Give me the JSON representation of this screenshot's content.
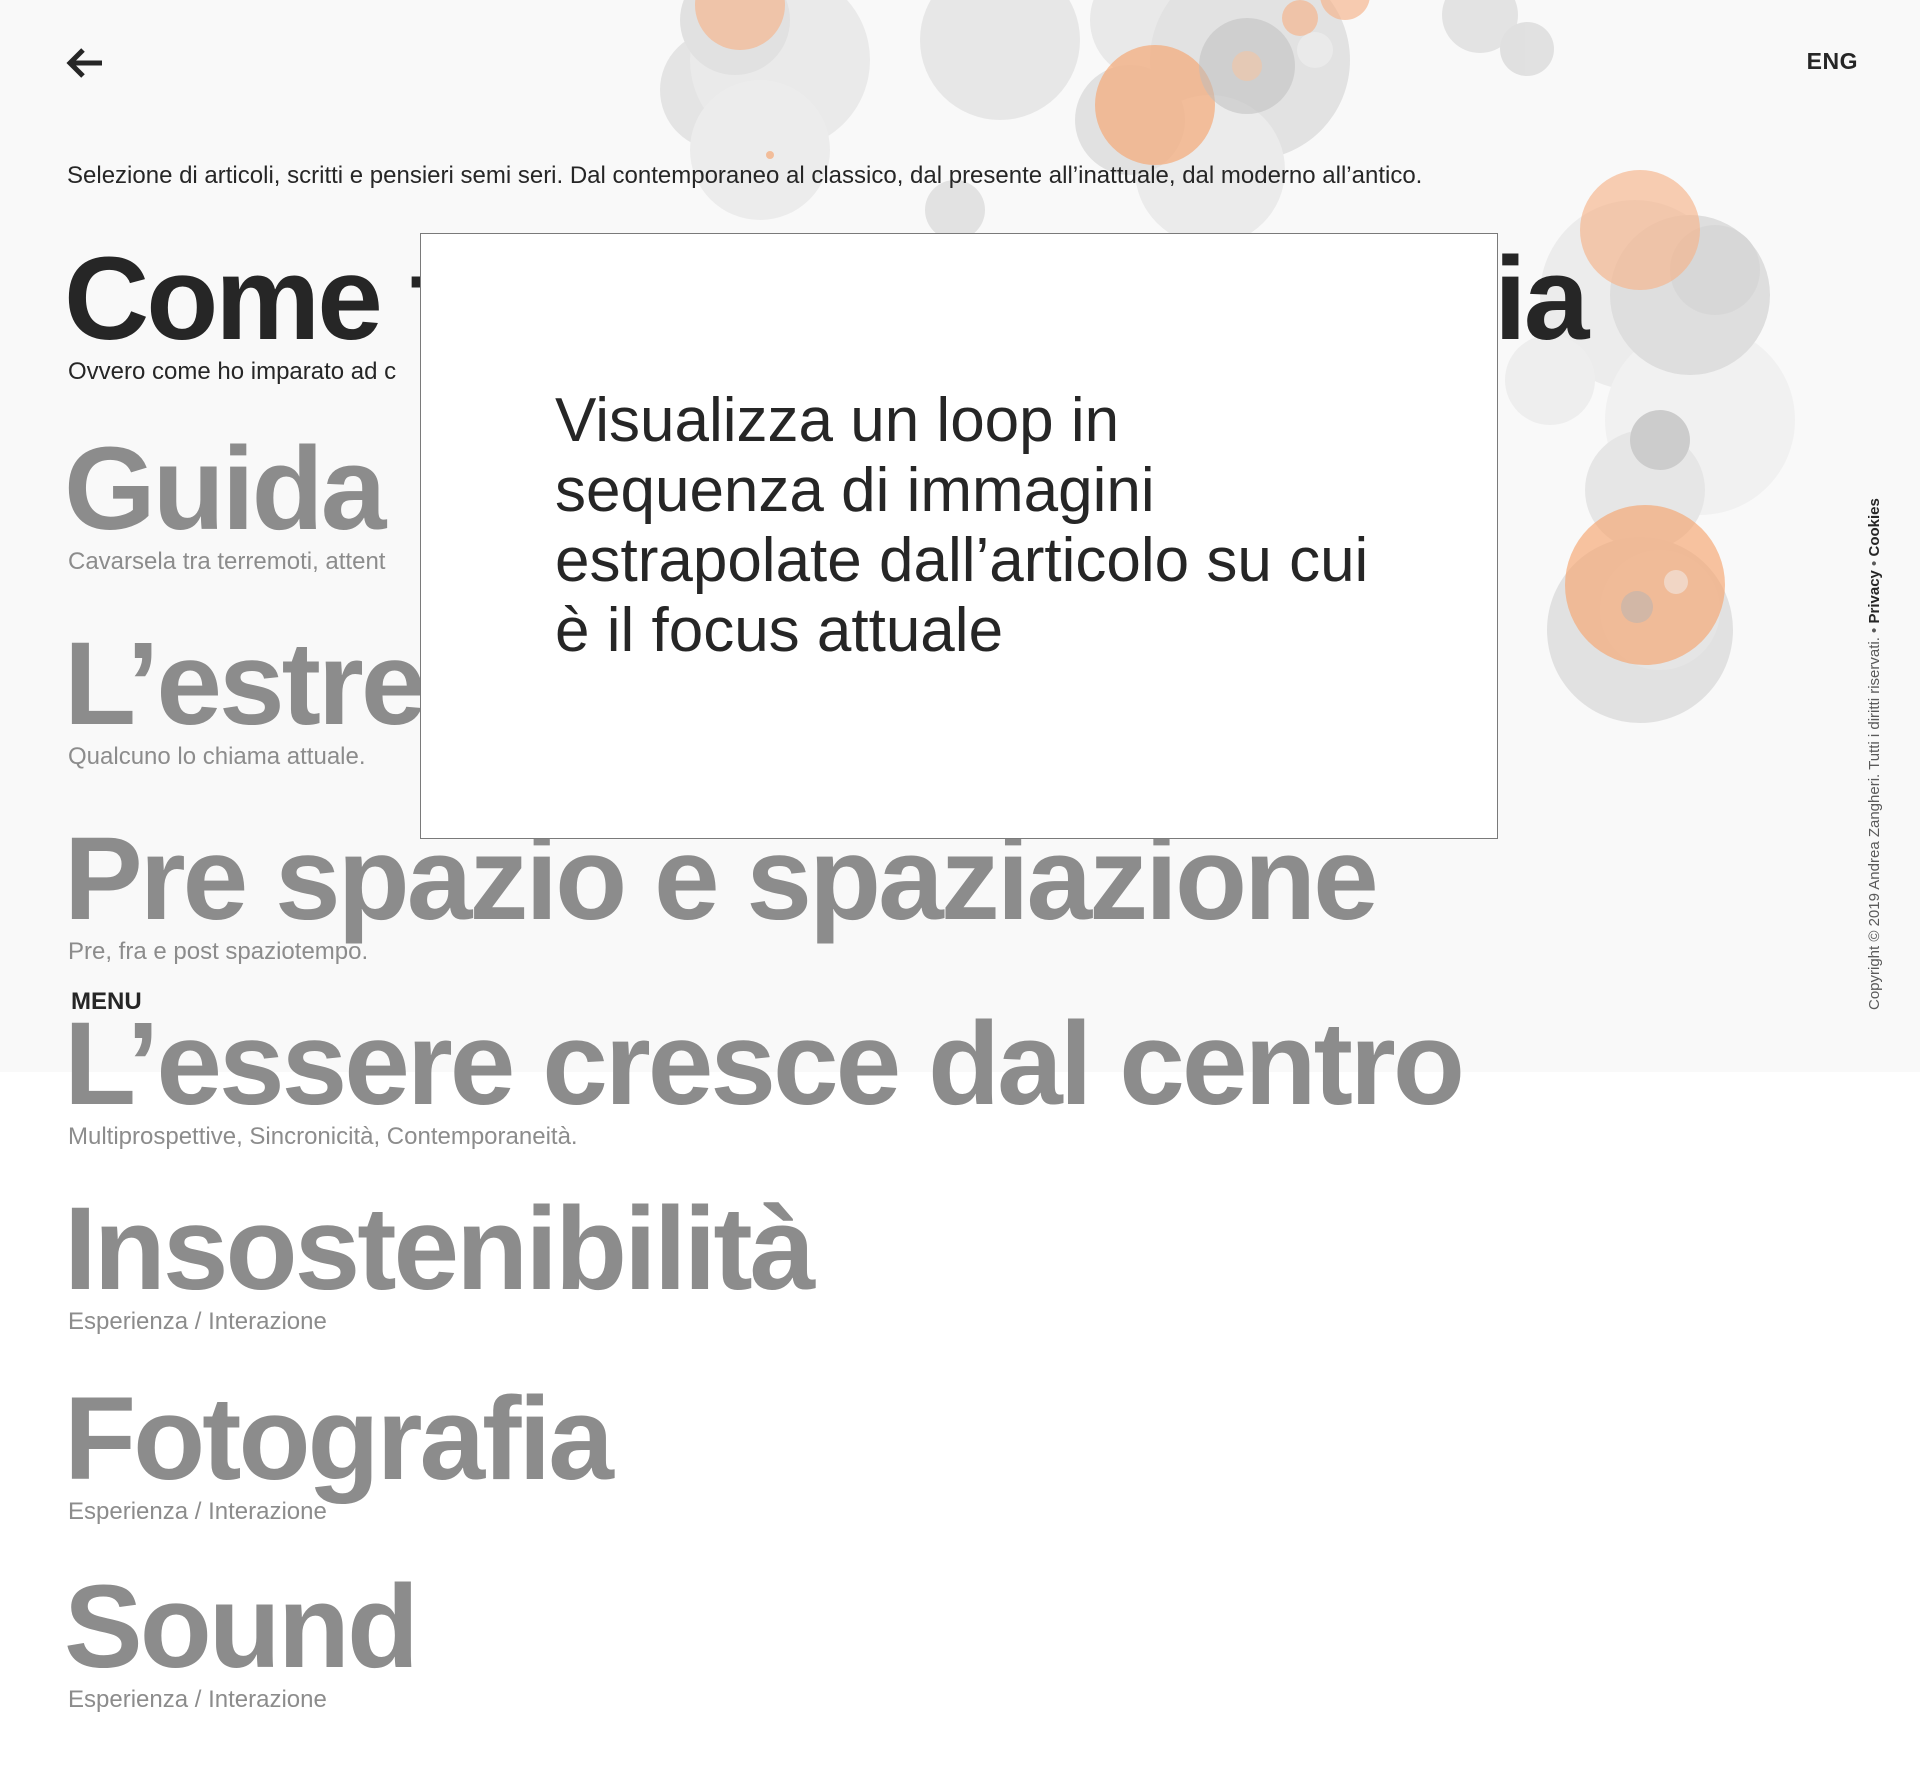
{
  "header": {
    "back_icon": "arrow-left-icon",
    "language_label": "ENG"
  },
  "intro_text": "Selezione di articoli, scritti e pensieri semi seri. Dal contemporaneo al classico, dal presente all’inattuale, dal moderno all’antico.",
  "articles": [
    {
      "title": "Come fare in caso di pioggia",
      "subtitle": "Ovvero come ho imparato ad c",
      "active": true
    },
    {
      "title": "Guida p",
      "subtitle": "Cavarsela tra terremoti, attent",
      "active": false
    },
    {
      "title": "L’estre",
      "subtitle": "Qualcuno lo chiama attuale.",
      "active": false
    },
    {
      "title": "Pre spazio e spaziazione",
      "subtitle": "Pre, fra e post spaziotempo.",
      "active": false
    },
    {
      "title": "L’essere cresce dal centro",
      "subtitle": "Multiprospettive, Sincronicità, Contemporaneità.",
      "active": false
    },
    {
      "title": "Insostenibilità",
      "subtitle": "Esperienza / Interazione",
      "active": false
    },
    {
      "title": "Fotografia",
      "subtitle": "Esperienza / Interazione",
      "active": false
    },
    {
      "title": "Sound",
      "subtitle": "Esperienza / Interazione",
      "active": false
    }
  ],
  "menu_label": "MENU",
  "overlay": {
    "text": "Visualizza un loop in sequenza di immagini estrapolate dall’articolo su cui è il focus attuale"
  },
  "footer": {
    "copyright": "Copyright © 2019 Andrea Zangheri. Tutti i diritti riservati.",
    "privacy": "Privacy",
    "cookies": "Cookies",
    "separator": "•"
  },
  "colors": {
    "text_dark": "#262626",
    "text_muted": "#8c8c8c",
    "accent_orange": "#f6b48a",
    "background_band": "#f9f9f9"
  }
}
